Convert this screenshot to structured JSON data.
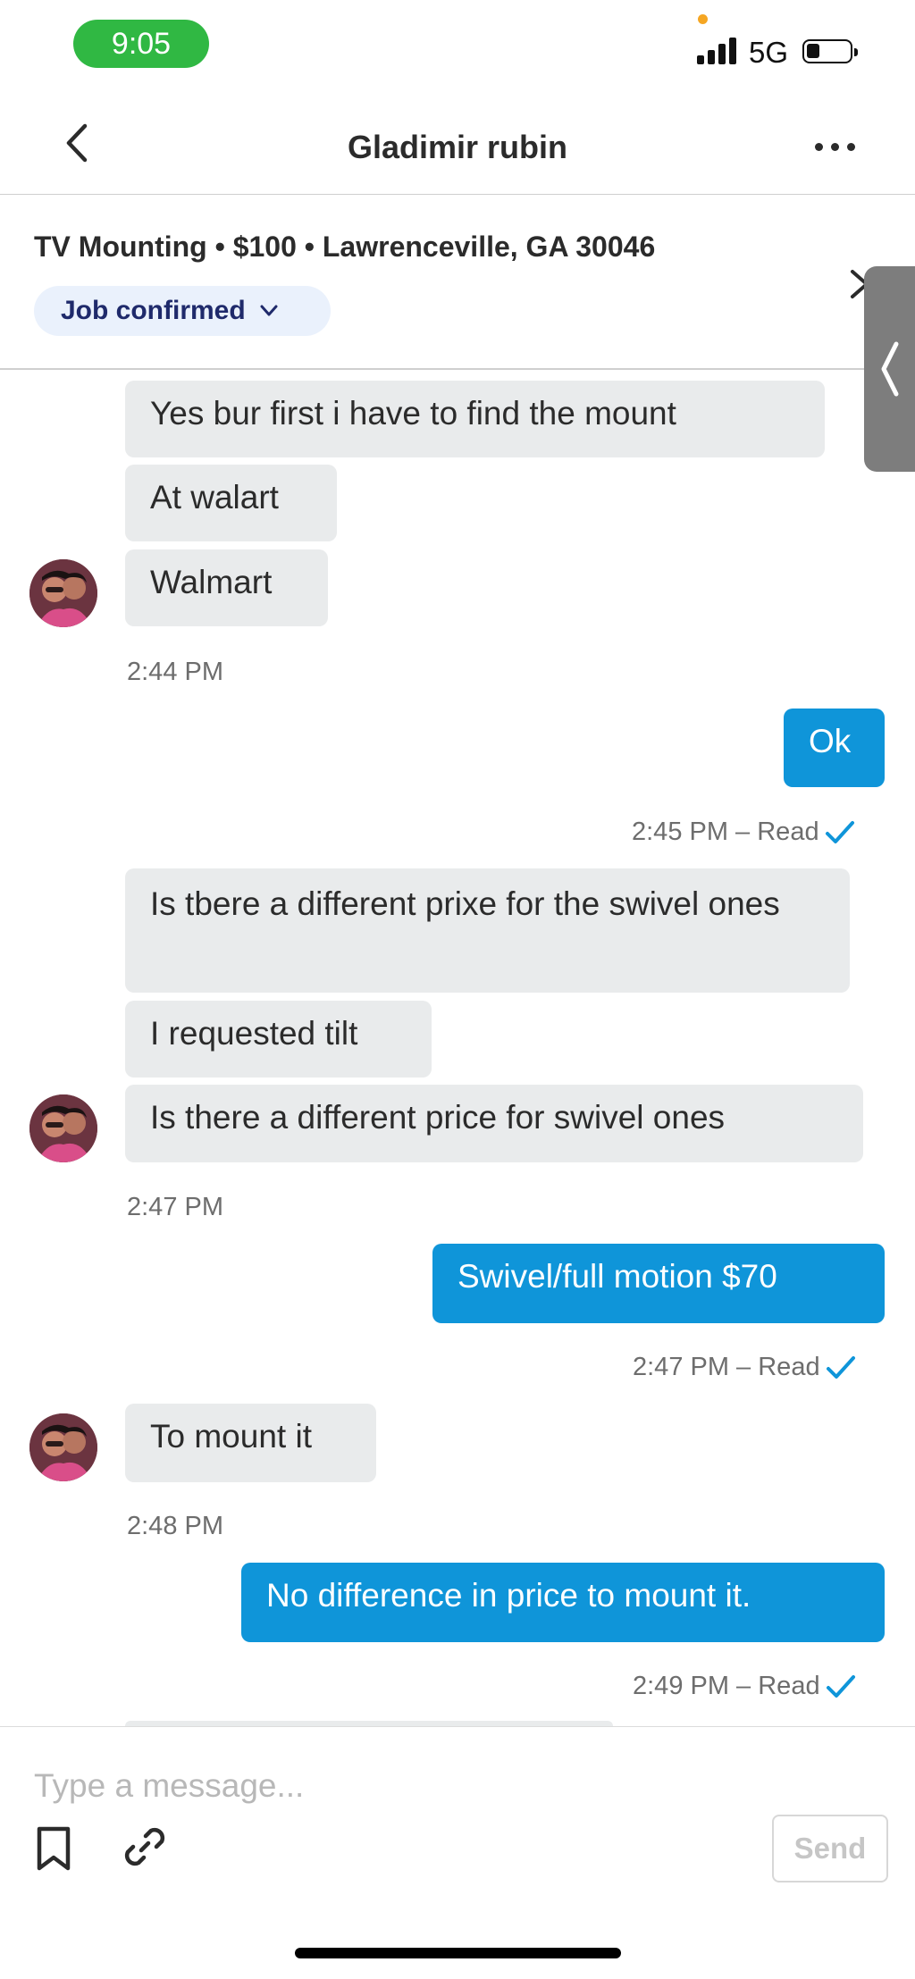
{
  "status_bar": {
    "time": "9:05",
    "network": "5G",
    "time_pill_color": "#30b843",
    "icons": [
      "signal-icon",
      "battery-icon"
    ]
  },
  "header": {
    "title": "Gladimir rubin",
    "icons": [
      "chevron-left-icon",
      "more-horizontal-icon"
    ]
  },
  "job": {
    "summary": "TV Mounting • $100 • Lawrenceville, GA 30046",
    "status_label": "Job confirmed",
    "icons": [
      "chevron-down-icon",
      "close-icon",
      "chevron-left-icon"
    ]
  },
  "messages": [
    {
      "side": "in",
      "text": "Yes bur first i have to find the mount"
    },
    {
      "side": "in",
      "text": "At walart"
    },
    {
      "side": "in",
      "text": "Walmart"
    },
    {
      "type": "timestamp",
      "text": "2:44 PM"
    },
    {
      "side": "out",
      "text": "Ok"
    },
    {
      "type": "timestamp",
      "text": "2:45 PM – Read"
    },
    {
      "side": "in",
      "text": "Is tbere a different prixe for the swivel ones"
    },
    {
      "side": "in",
      "text": "I requested tilt"
    },
    {
      "side": "in",
      "text": "Is there a different price for swivel ones"
    },
    {
      "type": "timestamp",
      "text": "2:47 PM"
    },
    {
      "side": "out",
      "text": "Swivel/full motion $70"
    },
    {
      "type": "timestamp",
      "text": "2:47 PM – Read"
    },
    {
      "side": "in",
      "text": "To mount it"
    },
    {
      "type": "timestamp",
      "text": "2:48 PM"
    },
    {
      "side": "out",
      "text": "No difference in price to mount it."
    },
    {
      "type": "timestamp",
      "text": "2:49 PM – Read"
    }
  ],
  "composer": {
    "placeholder": "Type a message...",
    "send_label": "Send",
    "icons": [
      "bookmark-icon",
      "link-icon"
    ]
  },
  "colors": {
    "outgoing_bubble": "#0f95d9",
    "incoming_bubble": "#e9ebec",
    "read_check": "#0f95d9",
    "badge_bg": "#eaf1fc",
    "badge_text": "#1f2a6b"
  }
}
